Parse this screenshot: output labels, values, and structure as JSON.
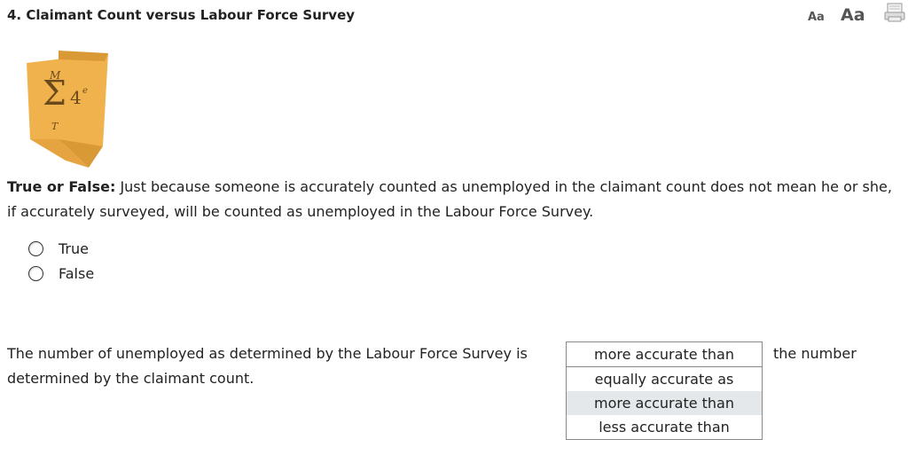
{
  "header": {
    "title": "4. Claimant Count versus Labour Force Survey",
    "font_small_label": "Aa",
    "font_large_label": "Aa",
    "print_icon": "print-icon"
  },
  "logo": {
    "icon": "math-sigma-badge-icon",
    "accent_color": "#f0b24d",
    "upper_limit": "M",
    "lower_limit": "T",
    "sigma": "Σ",
    "term": "4",
    "superscript": "e"
  },
  "question": {
    "prefix": "True or False:",
    "text": " Just because someone is accurately counted as unemployed in the claimant count does not mean he or she, if accurately surveyed, will be counted as unemployed in the Labour Force Survey.",
    "options": [
      {
        "label": "True"
      },
      {
        "label": "False"
      }
    ]
  },
  "sentence": {
    "before": "The number of unemployed as determined by the Labour Force Survey is",
    "before_line2": "determined by the claimant count.",
    "after": "the number",
    "dropdown": {
      "selected": "more accurate than",
      "options": [
        {
          "label": "equally accurate as"
        },
        {
          "label": "more accurate than"
        },
        {
          "label": "less accurate than"
        }
      ],
      "highlight_color": "#e4e8ea"
    }
  }
}
